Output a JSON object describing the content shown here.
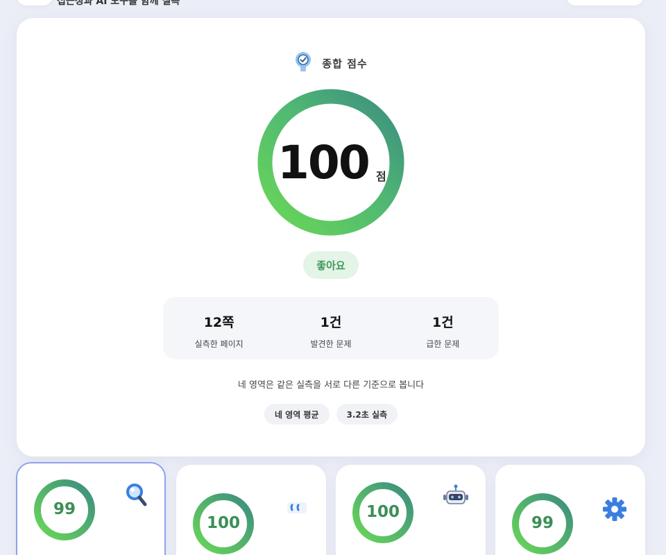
{
  "header": {
    "subtitle": "접근성과 AI 도구를 함께 실측"
  },
  "overall": {
    "title": "종합 점수",
    "score": "100",
    "unit": "점",
    "grade": "좋아요",
    "stats": [
      {
        "value": "12쪽",
        "label": "실측한 페이지"
      },
      {
        "value": "1건",
        "label": "발견한 문제"
      },
      {
        "value": "1건",
        "label": "급한 문제"
      }
    ],
    "note": "네 영역은 같은 실측을 서로 다른 기준으로 봅니다",
    "tags": [
      "네 영역 평균",
      "3.2초 실측"
    ]
  },
  "categories": [
    {
      "score": "99",
      "icon": "magnifier-icon",
      "selected": true
    },
    {
      "score": "100",
      "icon": "quote-icon",
      "selected": false
    },
    {
      "score": "100",
      "icon": "robot-icon",
      "selected": false
    },
    {
      "score": "99",
      "icon": "gear-icon",
      "selected": false
    }
  ],
  "colors": {
    "ring_start": "#5dd05f",
    "ring_end": "#3c8c80",
    "accent_text": "#3b8f55",
    "badge_bg": "#e4f4e7",
    "selected_border": "#8ea1ee"
  }
}
